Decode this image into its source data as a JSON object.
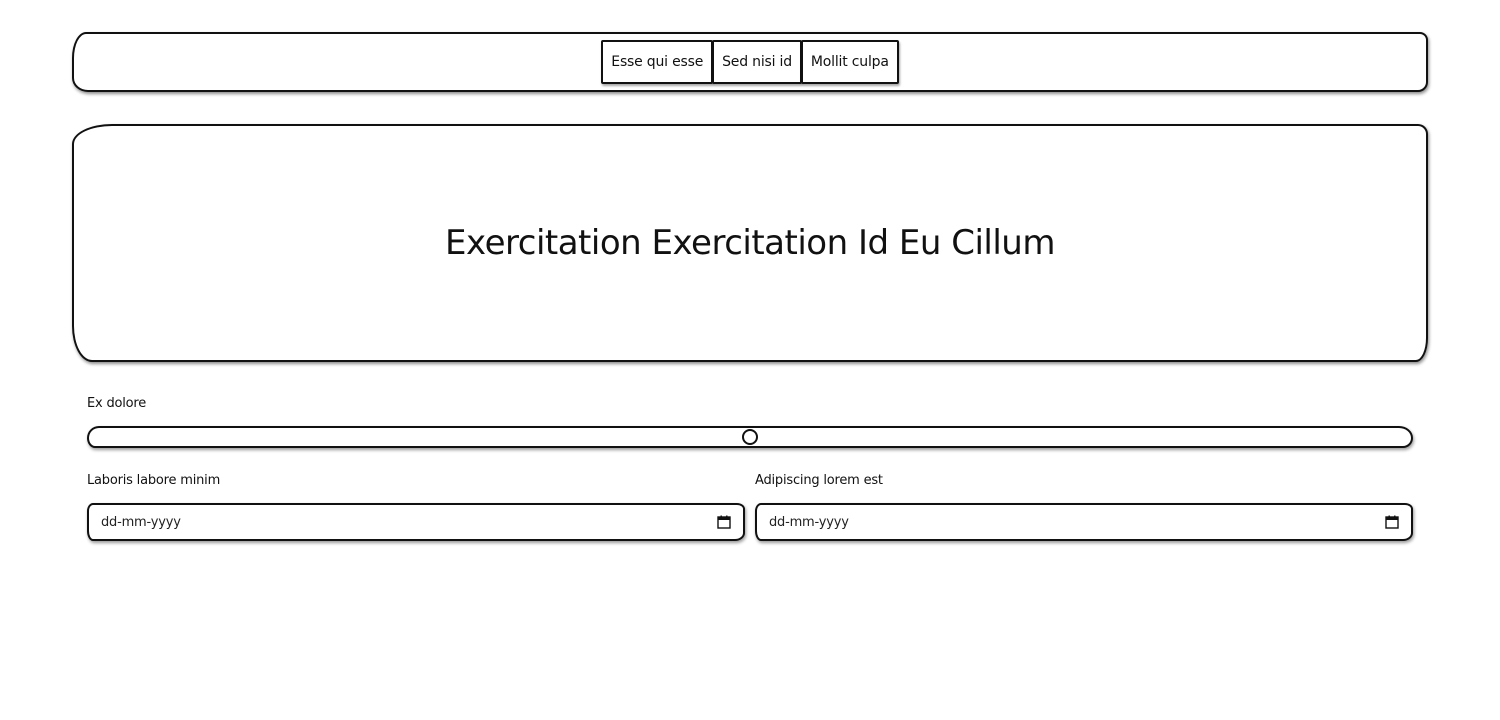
{
  "nav": {
    "buttons": [
      {
        "label": "Esse qui esse"
      },
      {
        "label": "Sed nisi id"
      },
      {
        "label": "Mollit culpa"
      }
    ]
  },
  "hero": {
    "title": "Exercitation Exercitation Id Eu Cillum"
  },
  "slider": {
    "label": "Ex dolore",
    "value_fraction": 0.5
  },
  "date_fields": [
    {
      "label": "Laboris labore minim",
      "placeholder": "dd-mm-yyyy",
      "icon": "calendar-icon"
    },
    {
      "label": "Adipiscing lorem est",
      "placeholder": "dd-mm-yyyy",
      "icon": "calendar-icon"
    }
  ]
}
